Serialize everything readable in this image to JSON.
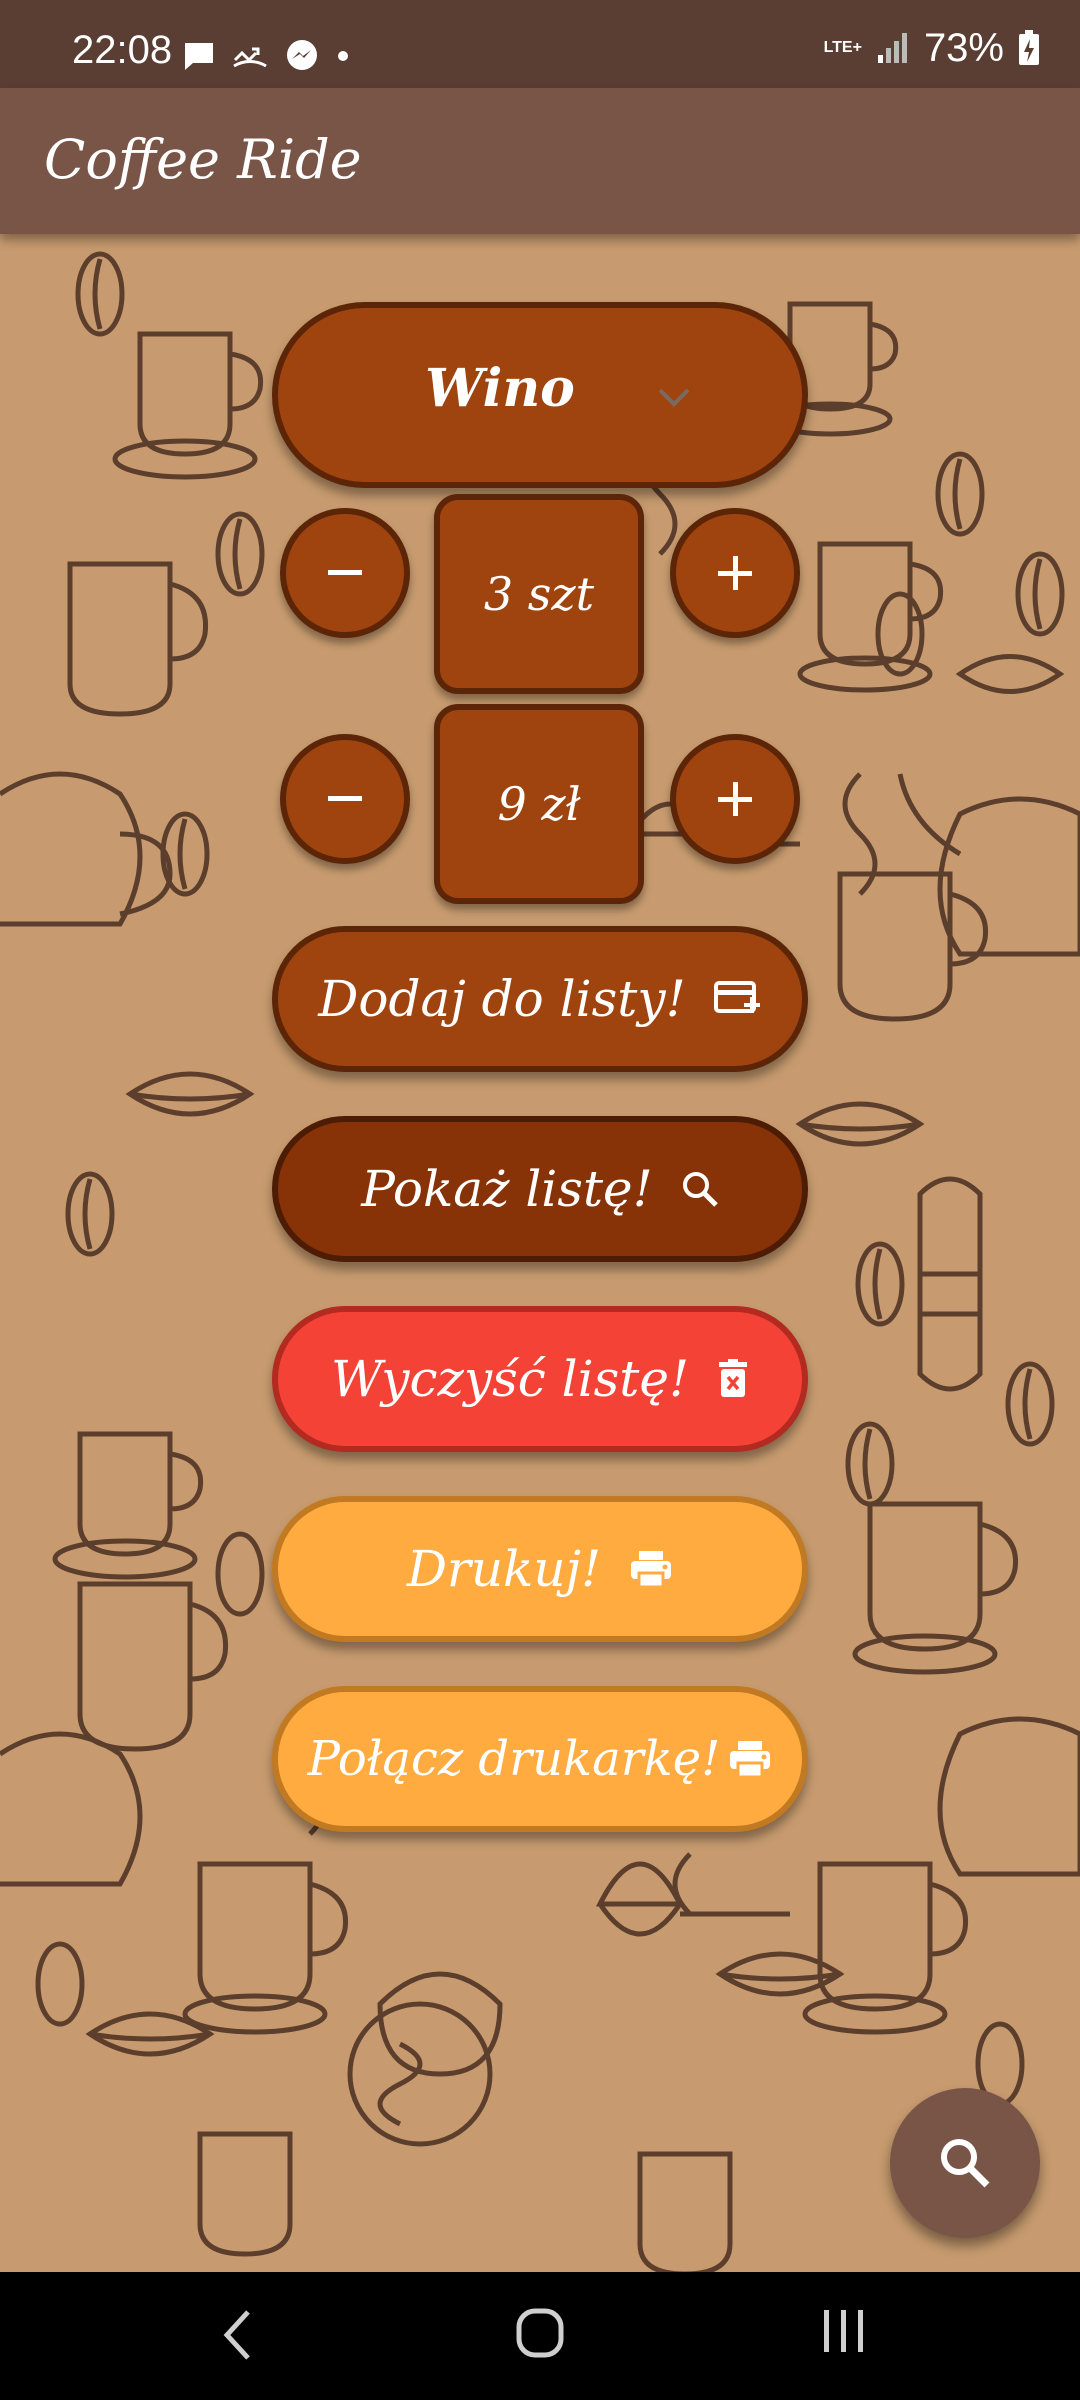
{
  "status_bar": {
    "time": "22:08",
    "network": "LTE+",
    "battery": "73%",
    "icons_left": [
      "chat-icon",
      "missed-call-icon",
      "messenger-icon",
      "dot-icon"
    ],
    "icons_right": [
      "lte-icon",
      "signal-icon",
      "battery-charging-icon"
    ]
  },
  "app_bar": {
    "title": "Coffee Ride"
  },
  "product_select": {
    "selected": "Wino"
  },
  "quantity": {
    "value": "3 szt"
  },
  "price": {
    "value": "9 zł"
  },
  "buttons": {
    "add": {
      "label": "Dodaj do listy!",
      "icon": "add-card-icon"
    },
    "show": {
      "label": "Pokaż listę!",
      "icon": "search-icon"
    },
    "clear": {
      "label": "Wyczyść listę!",
      "icon": "delete-icon"
    },
    "print": {
      "label": "Drukuj!",
      "icon": "print-icon"
    },
    "connect": {
      "label": "Połącz drukarkę!",
      "icon": "print-icon"
    }
  },
  "fab": {
    "icon": "search-icon"
  },
  "colors": {
    "status_bar": "#5a3d33",
    "app_bar": "#795548",
    "background": "#c79b6f",
    "brown_button": "#a0440f",
    "dark_brown_button": "#873307",
    "red_button": "#f44336",
    "orange_button": "#ffab40"
  },
  "nav_bar": {
    "buttons": [
      "back",
      "home",
      "recents"
    ]
  }
}
